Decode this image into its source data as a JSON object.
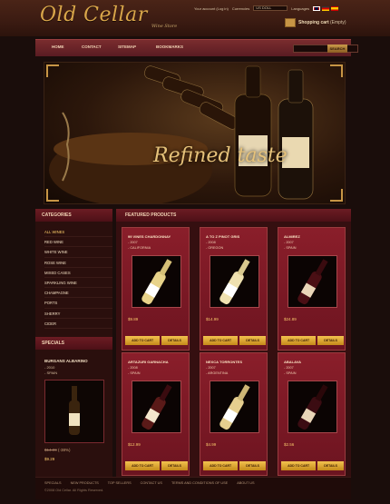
{
  "brand": {
    "name": "Old Cellar",
    "tagline": "Wine Store"
  },
  "topbar": {
    "account_label": "Your account (Log in)",
    "currencies_label": "Currencies",
    "currency_value": "US DOLL",
    "languages_label": "Languages"
  },
  "cart": {
    "label": "Shopping cart",
    "status": "(Empty)"
  },
  "nav": [
    "HOME",
    "CONTACT",
    "SITEMAP",
    "BOOKMARKS"
  ],
  "search": {
    "button": "SEARCH"
  },
  "banner": {
    "title": "Refined taste"
  },
  "categories": {
    "heading": "CATEGORIES",
    "items": [
      "ALL WINES",
      "RED WINE",
      "WHITE WINE",
      "ROSE WINE",
      "MIXED CASES",
      "SPARKLING WINE",
      "CHAMPAGNE",
      "PORTS",
      "SHERRY",
      "CIDER"
    ]
  },
  "specials": {
    "heading": "SPECIALS",
    "name": "BURGANS ALBARINO",
    "meta1": "- 2010",
    "meta2": "- SPAIN",
    "old_price": "$14.99",
    "discount": "(-38%)",
    "new_price": "$9.29"
  },
  "featured": {
    "heading": "FEATURED PRODUCTS",
    "add_label": "ADD TO CART",
    "details_label": "DETAILS",
    "products": [
      {
        "name": "99 VINES CHARDONNAY",
        "year": "- 2007",
        "origin": "- CALIFORNIA",
        "price": "$9.89"
      },
      {
        "name": "A TO Z PINOT GRIS",
        "year": "- 2008",
        "origin": "- OREGON",
        "price": "$14.99"
      },
      {
        "name": "ALMIREZ",
        "year": "- 2007",
        "origin": "- SPAIN",
        "price": "$24.89"
      },
      {
        "name": "ARTAZURI GARNACHA",
        "year": "- 2008",
        "origin": "- SPAIN",
        "price": "$12.99"
      },
      {
        "name": "NEXCA TORRONTES",
        "year": "- 2007",
        "origin": "- ARGENTINA",
        "price": "$4.99"
      },
      {
        "name": "ABALAVA",
        "year": "- 2007",
        "origin": "- SPAIN",
        "price": "$2.56"
      }
    ]
  },
  "footer": {
    "links": [
      "SPECIALS",
      "NEW PRODUCTS",
      "TOP SELLERS",
      "CONTACT US",
      "TERMS AND CONDITIONS OF USE",
      "ABOUT US"
    ],
    "copyright": "©2008 Old Cellar. All Rights Reserved."
  },
  "colors": {
    "accent": "#c79545",
    "panel": "#8a1e2a",
    "button": "#f3c34f"
  }
}
